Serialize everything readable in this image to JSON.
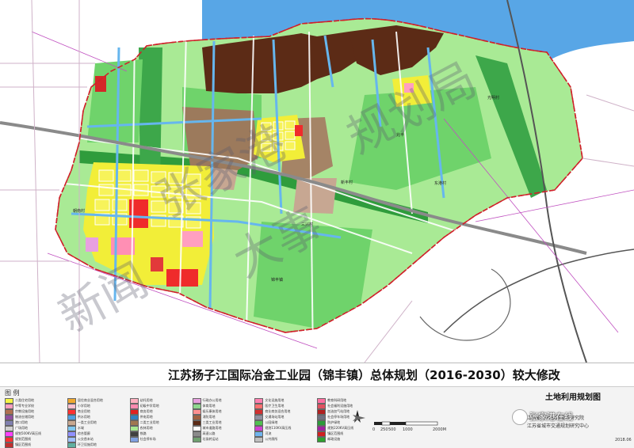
{
  "title": "江苏扬子江国际冶金工业园（锦丰镇）总体规划（2016-2030）较大修改",
  "map_name": "土地利用规划图",
  "legend": {
    "title": "图    例",
    "items": [
      {
        "label": "二类住宅用地",
        "color": "#f5f545"
      },
      {
        "label": "居住商业混合用地",
        "color": "#f0a830"
      },
      {
        "label": "幼托用地",
        "color": "#ffb0c0"
      },
      {
        "label": "行政办公用地",
        "color": "#e8a0e0"
      },
      {
        "label": "文化设施用地",
        "color": "#ff80b0"
      },
      {
        "label": "教育科研用地",
        "color": "#ff6fa0"
      },
      {
        "label": "中等专业学校",
        "color": "#ff9fc0"
      },
      {
        "label": "小学用地",
        "color": "#ffc0d0"
      },
      {
        "label": "初级中学用地",
        "color": "#ff8ab0"
      },
      {
        "label": "体育用地",
        "color": "#8fd88f"
      },
      {
        "label": "医疗卫生用地",
        "color": "#ff7070"
      },
      {
        "label": "社会福利设施用地",
        "color": "#e05060"
      },
      {
        "label": "宗教设施用地",
        "color": "#b07050"
      },
      {
        "label": "商业用地",
        "color": "#ff3030"
      },
      {
        "label": "商务用地",
        "color": "#e02020"
      },
      {
        "label": "娱乐康体用地",
        "color": "#ff9090"
      },
      {
        "label": "商业商务混合用地",
        "color": "#d03030"
      },
      {
        "label": "加油加气站用地",
        "color": "#b02020"
      },
      {
        "label": "物流仓储用地",
        "color": "#9050a0"
      },
      {
        "label": "供水用地",
        "color": "#50a0e0"
      },
      {
        "label": "供电用地",
        "color": "#3080c0"
      },
      {
        "label": "消防用地",
        "color": "#a06040"
      },
      {
        "label": "交通场站用地",
        "color": "#9090a0"
      },
      {
        "label": "社会停车场用地",
        "color": "#707080"
      },
      {
        "label": "港口用地",
        "color": "#8080b0"
      },
      {
        "label": "一类工业用地",
        "color": "#c8a890"
      },
      {
        "label": "二类工业用地",
        "color": "#a07850"
      },
      {
        "label": "三类工业用地",
        "color": "#5a2a15"
      },
      {
        "label": "公园绿地",
        "color": "#50c050"
      },
      {
        "label": "防护绿地",
        "color": "#2c9a3a"
      },
      {
        "label": "广场用地",
        "color": "#d0d0d0"
      },
      {
        "label": "水域",
        "color": "#80c8f0"
      },
      {
        "label": "农林用地",
        "color": "#a8e890"
      },
      {
        "label": "城市道路用地",
        "color": "#ffffff"
      },
      {
        "label": "规划110KV高压线",
        "color": "#d040d0"
      },
      {
        "label": "规划220KV高压线",
        "color": "#a020a0"
      },
      {
        "label": "规划500KV高压线",
        "color": "#ff40ff"
      },
      {
        "label": "综合管廊",
        "color": "#9090ff"
      },
      {
        "label": "铁路",
        "color": "#404040"
      },
      {
        "label": "高速公路",
        "color": "#8a8a8a"
      },
      {
        "label": "河流",
        "color": "#6fb4ee"
      },
      {
        "label": "镇区范围线",
        "color": "#d02020"
      },
      {
        "label": "规划范围线",
        "color": "#ff3030"
      },
      {
        "label": "公交首末站",
        "color": "#a0c0ff"
      },
      {
        "label": "社会停车场",
        "color": "#80a0e0"
      },
      {
        "label": "垃圾转运站",
        "color": "#70a070"
      },
      {
        "label": "公共厕所",
        "color": "#c0c0c0"
      },
      {
        "label": "邮政设施",
        "color": "#30a030"
      },
      {
        "label": "镇区范围线",
        "color": "#c03030"
      },
      {
        "label": "环卫设施用地",
        "color": "#60b0a0"
      }
    ]
  },
  "scale": {
    "labels": [
      "0",
      "250",
      "500",
      "1000",
      "2000M"
    ]
  },
  "org_line1": "江苏省城市规划设计研究院",
  "org_line2": "江苏省城市交通规划研究中心",
  "date": "2018.06",
  "wechat_name": "张家港在线",
  "watermark": {
    "w1": "张家港",
    "w2": "规划局",
    "w3": "新闻",
    "w4": "大事"
  },
  "map_labels": {
    "l1": "朝南村",
    "l2": "三兴村",
    "l3": "新丰村",
    "l4": "锦丰镇",
    "l5": "东港村",
    "l6": "光明村",
    "l7": "兆丰"
  },
  "colors": {
    "river": "#5aa8e6",
    "farmland": "#a9ea95",
    "green": "#6fd36b",
    "buffer": "#2f9c3c",
    "industry3": "#5c2b16",
    "industry2": "#9c7a5c",
    "industry1": "#c7a792",
    "residential": "#f2ee38",
    "commercial": "#ef2b2b",
    "boundary": "#d0202a",
    "background": "#ffffff"
  }
}
